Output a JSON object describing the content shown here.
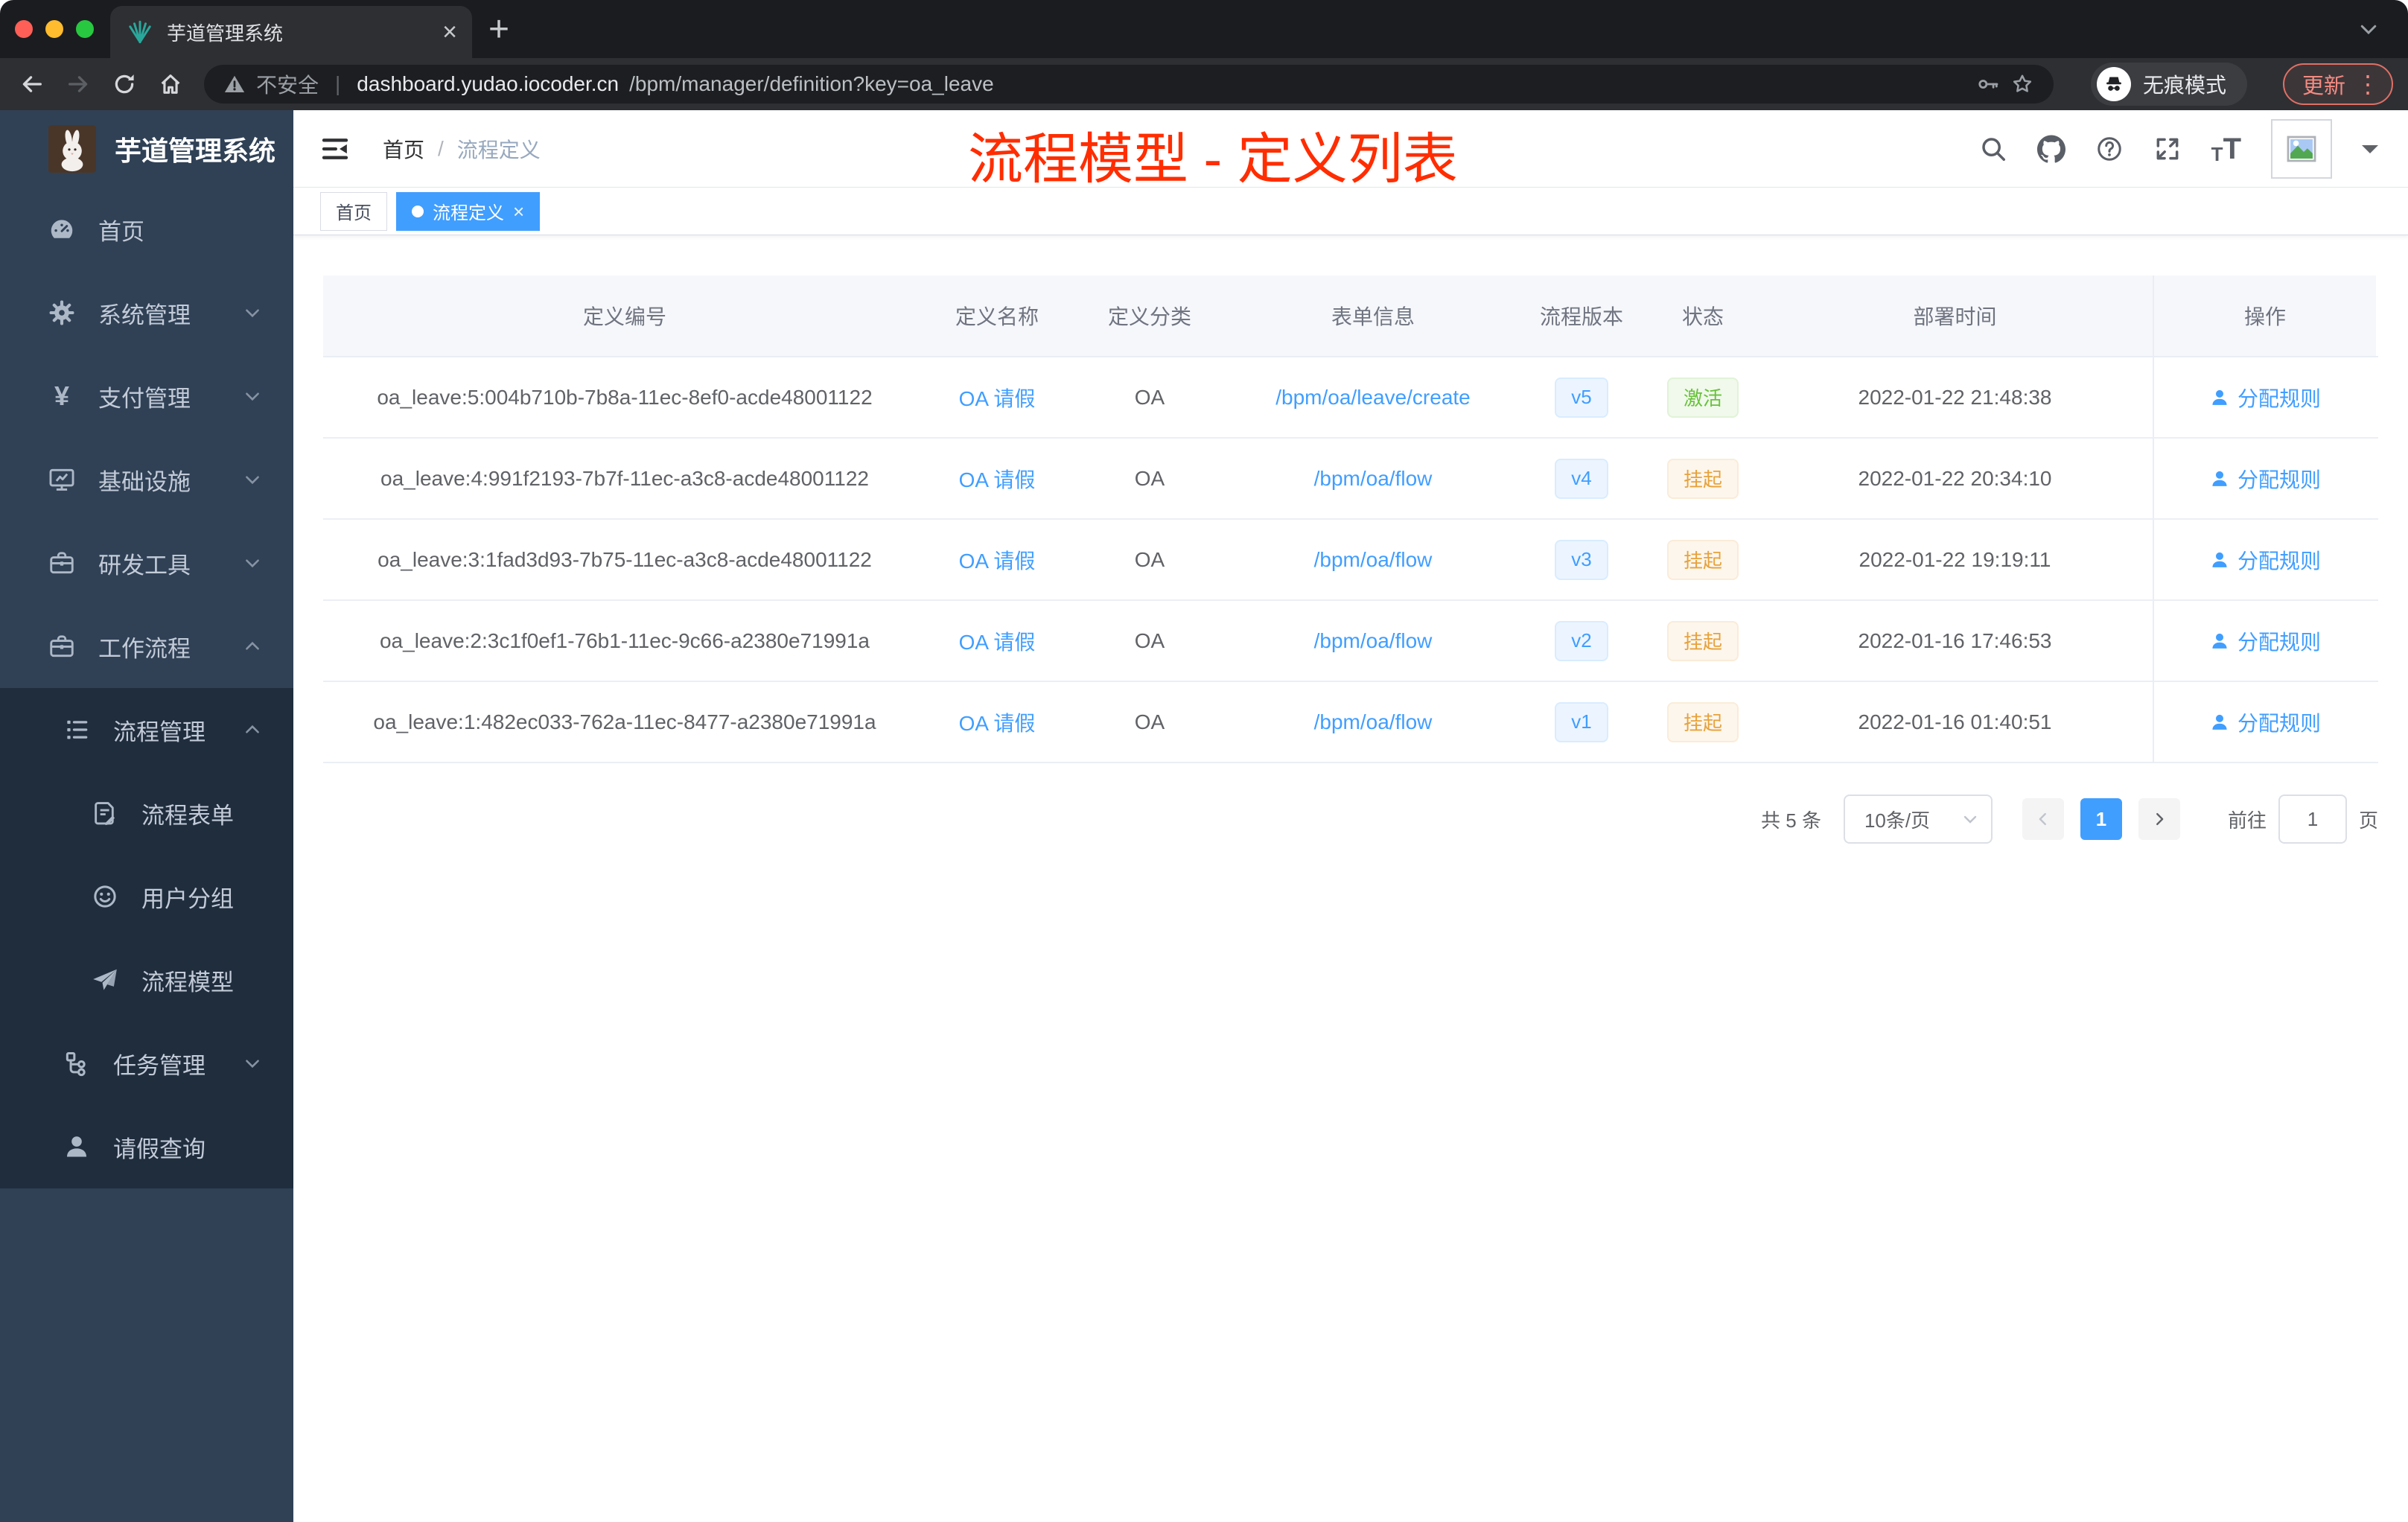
{
  "browser": {
    "tab": {
      "title": "芋道管理系统"
    },
    "address": {
      "security": "不安全",
      "domain": "dashboard.yudao.iocoder.cn",
      "path": "/bpm/manager/definition?key=oa_leave"
    },
    "incognito_label": "无痕模式",
    "update_label": "更新"
  },
  "sidebar": {
    "logo_title": "芋道管理系统",
    "menu": [
      {
        "label": "首页"
      },
      {
        "label": "系统管理"
      },
      {
        "label": "支付管理"
      },
      {
        "label": "基础设施"
      },
      {
        "label": "研发工具"
      },
      {
        "label": "工作流程"
      }
    ],
    "submenu": [
      {
        "label": "流程管理"
      },
      {
        "label": "流程表单"
      },
      {
        "label": "用户分组"
      },
      {
        "label": "流程模型"
      },
      {
        "label": "任务管理"
      },
      {
        "label": "请假查询"
      }
    ],
    "yen_glyph": "¥"
  },
  "navbar": {
    "breadcrumb_home": "首页",
    "breadcrumb_sep": "/",
    "breadcrumb_current": "流程定义",
    "annotation": "流程模型 - 定义列表"
  },
  "tags": [
    {
      "label": "首页",
      "active": false
    },
    {
      "label": "流程定义",
      "active": true
    }
  ],
  "table": {
    "columns": [
      {
        "key": "id",
        "label": "定义编号"
      },
      {
        "key": "name",
        "label": "定义名称"
      },
      {
        "key": "category",
        "label": "定义分类"
      },
      {
        "key": "form",
        "label": "表单信息"
      },
      {
        "key": "version",
        "label": "流程版本"
      },
      {
        "key": "status",
        "label": "状态"
      },
      {
        "key": "time",
        "label": "部署时间"
      },
      {
        "key": "action",
        "label": "操作"
      }
    ],
    "rows": [
      {
        "id": "oa_leave:5:004b710b-7b8a-11ec-8ef0-acde48001122",
        "name": "OA 请假",
        "category": "OA",
        "form": "/bpm/oa/leave/create",
        "version": "v5",
        "status": "激活",
        "status_variant": "success",
        "time": "2022-01-22 21:48:38",
        "action": "分配规则"
      },
      {
        "id": "oa_leave:4:991f2193-7b7f-11ec-a3c8-acde48001122",
        "name": "OA 请假",
        "category": "OA",
        "form": "/bpm/oa/flow",
        "version": "v4",
        "status": "挂起",
        "status_variant": "warning",
        "time": "2022-01-22 20:34:10",
        "action": "分配规则"
      },
      {
        "id": "oa_leave:3:1fad3d93-7b75-11ec-a3c8-acde48001122",
        "name": "OA 请假",
        "category": "OA",
        "form": "/bpm/oa/flow",
        "version": "v3",
        "status": "挂起",
        "status_variant": "warning",
        "time": "2022-01-22 19:19:11",
        "action": "分配规则"
      },
      {
        "id": "oa_leave:2:3c1f0ef1-76b1-11ec-9c66-a2380e71991a",
        "name": "OA 请假",
        "category": "OA",
        "form": "/bpm/oa/flow",
        "version": "v2",
        "status": "挂起",
        "status_variant": "warning",
        "time": "2022-01-16 17:46:53",
        "action": "分配规则"
      },
      {
        "id": "oa_leave:1:482ec033-762a-11ec-8477-a2380e71991a",
        "name": "OA 请假",
        "category": "OA",
        "form": "/bpm/oa/flow",
        "version": "v1",
        "status": "挂起",
        "status_variant": "warning",
        "time": "2022-01-16 01:40:51",
        "action": "分配规则"
      }
    ]
  },
  "pagination": {
    "total": "共 5 条",
    "page_size": "10条/页",
    "page": "1",
    "goto_label": "前往",
    "goto_value": "1",
    "unit": "页"
  },
  "colors": {
    "accent": "#409eff",
    "annotation_red": "#ff2d00",
    "success": "#67c23a",
    "warning": "#e6a23c",
    "sidebar_bg": "#304156",
    "submenu_bg": "#1f2d3d"
  }
}
